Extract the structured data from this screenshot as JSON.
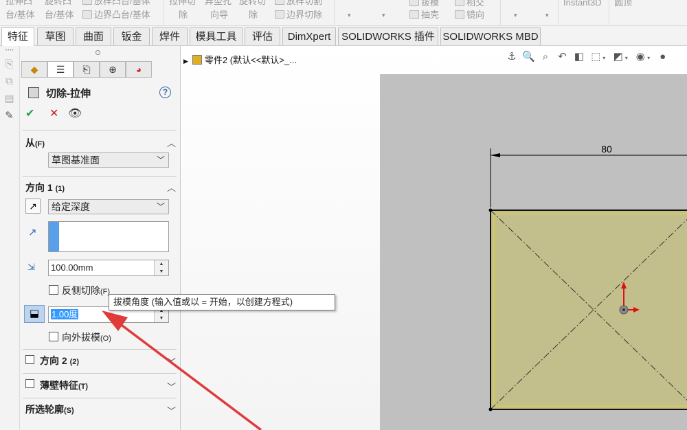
{
  "ribbon": {
    "items": [
      {
        "label": "拉伸凸台/基体",
        "short": "拉伸凸"
      },
      {
        "label": "旋转凸台/基体",
        "short": "旋转凸"
      },
      {
        "label": "放样凸台/基体"
      },
      {
        "label": "边界凸台/基体"
      },
      {
        "label": "拉伸切除",
        "short": "拉伸切"
      },
      {
        "label": "异型孔向导",
        "short": "异型孔"
      },
      {
        "label": "旋转切除",
        "short": "旋转切"
      },
      {
        "label": "放样切割"
      },
      {
        "label": "边界切除"
      },
      {
        "label": "拔模"
      },
      {
        "label": "抽壳"
      },
      {
        "label": "相交"
      },
      {
        "label": "镜向"
      },
      {
        "label": "Instant3D"
      },
      {
        "label": "圆顶"
      }
    ]
  },
  "command_tabs": [
    {
      "label": "特征",
      "active": true
    },
    {
      "label": "草图"
    },
    {
      "label": "曲面"
    },
    {
      "label": "钣金"
    },
    {
      "label": "焊件"
    },
    {
      "label": "模具工具"
    },
    {
      "label": "评估"
    },
    {
      "label": "DimXpert"
    },
    {
      "label": "SOLIDWORKS 插件"
    },
    {
      "label": "SOLIDWORKS MBD"
    }
  ],
  "property_manager": {
    "title": "切除-拉伸",
    "help": "?",
    "ok": "✔",
    "cancel": "✕",
    "preview": "👁",
    "from": {
      "title": "从",
      "shortcut": "(F)",
      "start_condition": "草图基准面"
    },
    "direction1": {
      "title": "方向 1",
      "shortcut": "(1)",
      "end_condition": "给定深度",
      "depth": "100.00mm",
      "flip_side_label": "反侧切除",
      "flip_side_shortcut": "(F)",
      "draft_angle": "1.00度",
      "draft_outward_label": "向外拔模",
      "draft_outward_shortcut": "(O)"
    },
    "direction2": {
      "title": "方向 2",
      "shortcut": "(2)"
    },
    "thin_feature": {
      "title": "薄壁特征",
      "shortcut": "(T)"
    },
    "selected_contours": {
      "title": "所选轮廓",
      "shortcut": "(S)"
    }
  },
  "tooltip": {
    "text": "拔模角度  (输入值或以 = 开始，以创建方程式)"
  },
  "graphics": {
    "tree_item": "零件2  (默认<<默认>_...",
    "dimension": "80"
  },
  "colors": {
    "sketch_fill": "#c2bf8c",
    "sketch_inner_line": "#d6cf4e",
    "sheet": "#c0c0c0",
    "annotation_arrow": "#e03a3a",
    "selection_blue": "#5aa0e8"
  }
}
